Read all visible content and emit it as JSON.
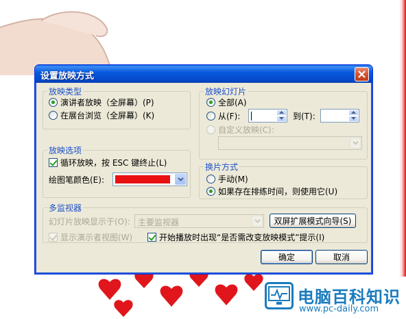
{
  "dialog": {
    "title": "设置放映方式",
    "show_type": {
      "title": "放映类型",
      "options": [
        "演讲者放映（全屏幕）(P)",
        "在展台浏览（全屏幕）(K)"
      ]
    },
    "show_options": {
      "title": "放映选项",
      "loop_label": "循环放映，按 ESC 键终止(L)",
      "pen_color_label": "绘图笔颜色(E):",
      "pen_color": "#e81010"
    },
    "slides": {
      "title": "放映幻灯片",
      "all_label": "全部(A)",
      "from_label": "从(F):",
      "to_label": "到(T):",
      "custom_label": "自定义放映(C):"
    },
    "advance": {
      "title": "换片方式",
      "manual_label": "手动(M)",
      "timings_label": "如果存在排练时间，则使用它(U)"
    },
    "monitors": {
      "title": "多监视器",
      "display_on_label": "幻灯片放映显示于(O):",
      "display_on_value": "主要监视器",
      "wizard_button": "双屏扩展模式向导(S)",
      "presenter_view_label": "显示演示者视图(W)",
      "prompt_label": "开始播放时出现“是否需改变放映模式”提示(I)"
    },
    "ok_label": "确定",
    "cancel_label": "取消"
  },
  "watermark": {
    "title": "电脑百科知识",
    "url": "www.pc-daily.com"
  },
  "colors": {
    "titlebar": "#0a5ae0",
    "group_title": "#1d50c8",
    "brand": "#1a7bbd"
  }
}
